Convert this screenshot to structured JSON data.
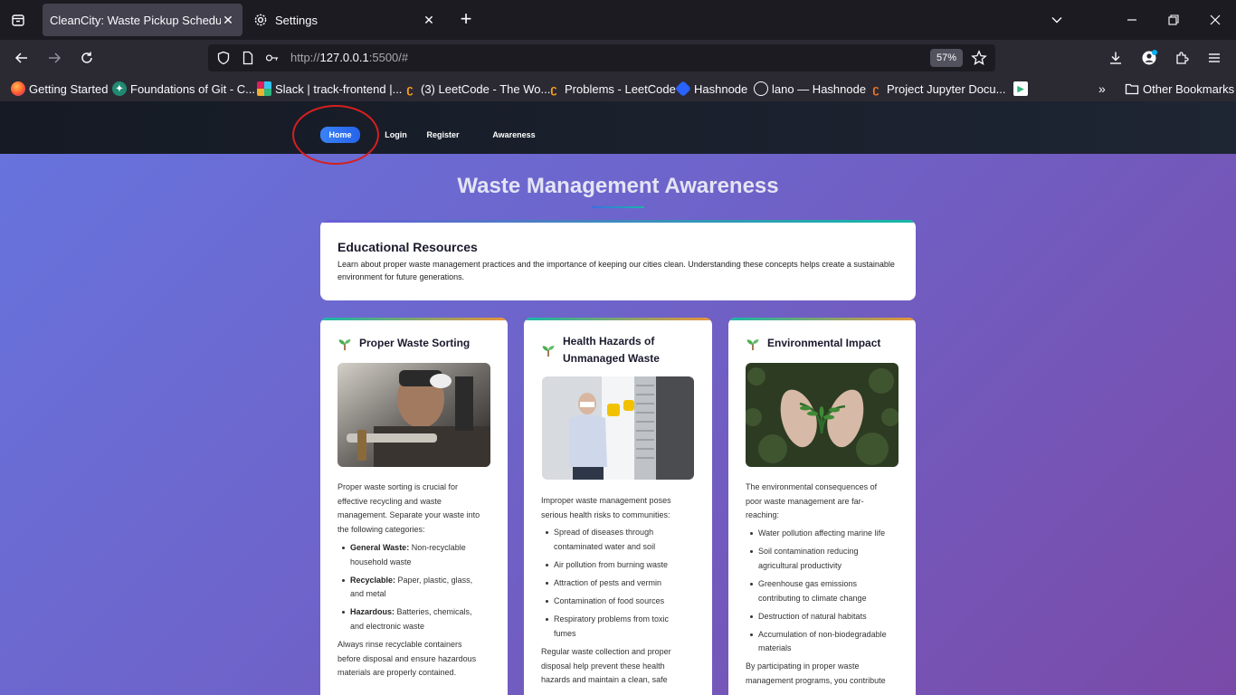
{
  "browser": {
    "tabs": [
      {
        "title": "CleanCity: Waste Pickup Scheduler",
        "active": true
      },
      {
        "title": "Settings",
        "active": false
      }
    ],
    "url": {
      "prefix": "http://",
      "host": "127.0.0.1",
      "path": ":5500/#"
    },
    "zoom": "57%",
    "bookmarks": [
      {
        "label": "Getting Started",
        "icon": "firefox-icon"
      },
      {
        "label": "Foundations of Git - C...",
        "icon": "git-course-icon"
      },
      {
        "label": "Slack | track-frontend |...",
        "icon": "slack-icon"
      },
      {
        "label": "(3) LeetCode - The Wo...",
        "icon": "leetcode-icon"
      },
      {
        "label": "Problems - LeetCode",
        "icon": "leetcode-icon"
      },
      {
        "label": "Hashnode",
        "icon": "hashnode-icon"
      },
      {
        "label": "lano — Hashnode",
        "icon": "globe-icon"
      },
      {
        "label": "Project Jupyter Docu...",
        "icon": "jupyter-icon"
      }
    ],
    "other_bookmarks": "Other Bookmarks"
  },
  "site": {
    "nav": [
      {
        "label": "Home",
        "active": true
      },
      {
        "label": "Login",
        "active": false
      },
      {
        "label": "Register",
        "active": false
      },
      {
        "label": "Awareness",
        "active": false
      }
    ],
    "title": "Waste Management Awareness",
    "education": {
      "heading": "Educational Resources",
      "text": "Learn about proper waste management practices and the importance of keeping our cities clean. Understanding these concepts helps create a sustainable environment for future generations."
    },
    "topics": [
      {
        "title": "Proper Waste Sorting",
        "intro": "Proper waste sorting is crucial for effective recycling and waste management. Separate your waste into the following categories:",
        "items": [
          {
            "strong": "General Waste:",
            "text": " Non-recyclable household waste"
          },
          {
            "strong": "Recyclable:",
            "text": " Paper, plastic, glass, and metal"
          },
          {
            "strong": "Hazardous:",
            "text": " Batteries, chemicals, and electronic waste"
          }
        ],
        "outro": "Always rinse recyclable containers before disposal and ensure hazardous materials are properly contained."
      },
      {
        "title": "Health Hazards of Unmanaged Waste",
        "intro": "Improper waste management poses serious health risks to communities:",
        "items": [
          {
            "strong": "",
            "text": "Spread of diseases through contaminated water and soil"
          },
          {
            "strong": "",
            "text": "Air pollution from burning waste"
          },
          {
            "strong": "",
            "text": "Attraction of pests and vermin"
          },
          {
            "strong": "",
            "text": "Contamination of food sources"
          },
          {
            "strong": "",
            "text": "Respiratory problems from toxic fumes"
          }
        ],
        "outro": "Regular waste collection and proper disposal help prevent these health hazards and maintain a clean, safe"
      },
      {
        "title": "Environmental Impact",
        "intro": "The environmental consequences of poor waste management are far-reaching:",
        "items": [
          {
            "strong": "",
            "text": "Water pollution affecting marine life"
          },
          {
            "strong": "",
            "text": "Soil contamination reducing agricultural productivity"
          },
          {
            "strong": "",
            "text": "Greenhouse gas emissions contributing to climate change"
          },
          {
            "strong": "",
            "text": "Destruction of natural habitats"
          },
          {
            "strong": "",
            "text": "Accumulation of non-biodegradable materials"
          }
        ],
        "outro": "By participating in proper waste management programs, you contribute"
      }
    ]
  }
}
